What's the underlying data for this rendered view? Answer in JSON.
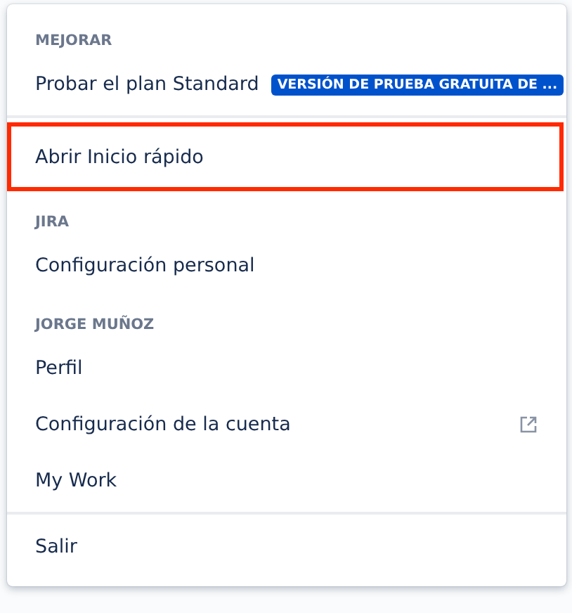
{
  "menu": {
    "sections": [
      {
        "header": "MEJORAR",
        "divider_above": false,
        "items": [
          {
            "label": "Probar el plan Standard",
            "kind": "plain",
            "badge": "VERSIÓN DE PRUEBA GRATUITA DE ...",
            "highlighted": false
          }
        ]
      },
      {
        "divider_above": true,
        "items": [
          {
            "label": "Abrir Inicio rápido",
            "kind": "plain",
            "highlighted": true
          }
        ]
      },
      {
        "header": "JIRA",
        "divider_above": false,
        "items": [
          {
            "label": "Configuración personal",
            "kind": "plain",
            "highlighted": false
          }
        ]
      },
      {
        "header": "JORGE MUÑOZ",
        "divider_above": false,
        "items": [
          {
            "label": "Perfil",
            "kind": "plain",
            "highlighted": false
          },
          {
            "label": "Configuración de la cuenta",
            "kind": "external",
            "highlighted": false
          },
          {
            "label": "My Work",
            "kind": "plain",
            "highlighted": false
          }
        ]
      },
      {
        "divider_above": true,
        "items": [
          {
            "label": "Salir",
            "kind": "plain",
            "highlighted": false
          }
        ]
      }
    ]
  }
}
